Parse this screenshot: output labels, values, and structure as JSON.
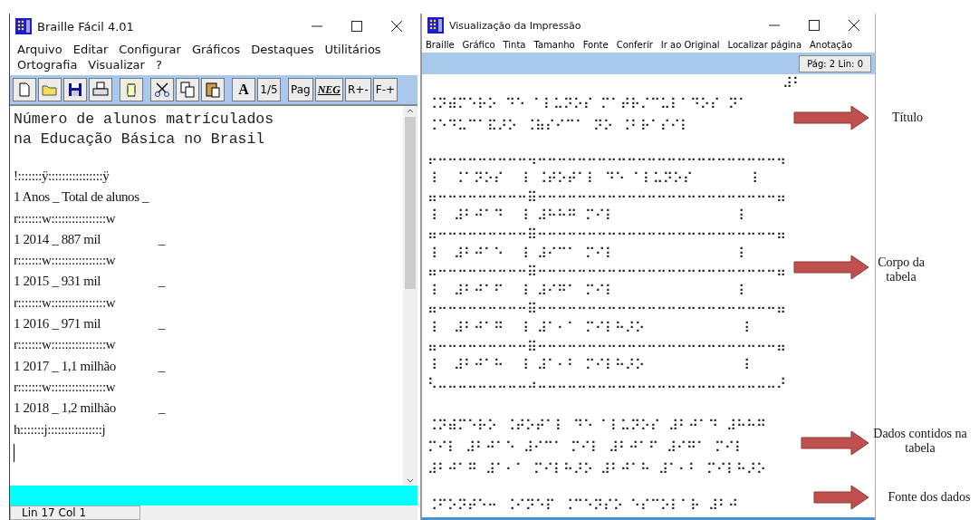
{
  "editor_window": {
    "title": "Braille Fácil 4.01",
    "menu": [
      "Arquivo",
      "Editar",
      "Configurar",
      "Gráficos",
      "Destaques",
      "Utilitários",
      "Ortografia",
      "Visualizar",
      "?"
    ],
    "toolbar_labels": [
      "A",
      "1/5",
      "Pag",
      "NEG",
      "R+-",
      "F-+"
    ],
    "heading": [
      "Número de alunos matrículados",
      "na Educação Básica no Brasil"
    ],
    "lines": [
      {
        "text": "!:::::::ÿ::::::::::::::::ÿ"
      },
      {
        "text": "1 Anos _ Total de alunos _"
      },
      {
        "text": "r:::::::w::::::::::::::::w"
      },
      {
        "text": "1 2014 _ 887 mil",
        "tail": "_"
      },
      {
        "text": "r:::::::w::::::::::::::::w"
      },
      {
        "text": "1 2015 _ 931 mil",
        "tail": "_"
      },
      {
        "text": "r:::::::w::::::::::::::::w"
      },
      {
        "text": "1 2016 _ 971 mil",
        "tail": "_"
      },
      {
        "text": "r:::::::w::::::::::::::::w"
      },
      {
        "text": "1 2017 _ 1,1 milhão",
        "tail": "_"
      },
      {
        "text": "r:::::::w::::::::::::::::w"
      },
      {
        "text": "1 2018 _ 1,2 milhão",
        "tail": "_"
      },
      {
        "text": "h:::::::j::::::::::::::::j"
      }
    ],
    "status": "Lin 17  Col 1"
  },
  "preview_window": {
    "title": "Visualização da Impressão",
    "menu": [
      "Braille",
      "Gráfico",
      "Tinta",
      "Tamanho",
      "Fonte",
      "Conferir",
      "Ir ao Original",
      "Localizar página",
      "Anotação"
    ],
    "page_indicator": "Pág: 2  Lin: 0",
    "page_number": "⠼⠃",
    "title_lines": [
      "⠨⠝⠾⠍⠑⠗⠕ ⠙⠑ ⠁⠇⠥⠝⠕⠎ ⠍⠁⠞⠗⠌⠉⠥⠇⠁⠙⠕⠎ ⠝⠁",
      "⠨⠑⠙⠥⠉⠁⠯⠜⠕ ⠨⠷⠎⠊⠉⠁ ⠝⠕ ⠨⠃⠗⠁⠎⠊⠇"
    ],
    "table_lines": [
      "⠖⠒⠒⠒⠒⠒⠒⠒⠒⠒⠲⠒⠒⠒⠒⠒⠒⠒⠒⠒⠒⠒⠒⠒⠒⠒⠒⠒⠒⠒⠒⠒⠒⠒⠒⠲",
      "⠸  ⠨⠁⠝⠕⠎  ⠸ ⠨⠞⠕⠞⠁⠇ ⠙⠑ ⠁⠇⠥⠝⠕⠎       ⠸",
      "⠶⠒⠒⠒⠒⠒⠒⠒⠒⠒⠿⠒⠒⠒⠒⠒⠒⠒⠒⠒⠒⠒⠒⠒⠒⠒⠒⠒⠒⠒⠒⠒⠒⠒⠒⠶",
      "⠸  ⠼⠃⠚⠁⠙  ⠸ ⠼⠓⠓⠛ ⠍⠊⠇               ⠸",
      "⠶⠒⠒⠒⠒⠒⠒⠒⠒⠒⠿⠒⠒⠒⠒⠒⠒⠒⠒⠒⠒⠒⠒⠒⠒⠒⠒⠒⠒⠒⠒⠒⠒⠒⠒⠶",
      "⠸  ⠼⠃⠚⠁⠑  ⠸ ⠼⠊⠉⠁ ⠍⠊⠇               ⠸",
      "⠶⠒⠒⠒⠒⠒⠒⠒⠒⠒⠿⠒⠒⠒⠒⠒⠒⠒⠒⠒⠒⠒⠒⠒⠒⠒⠒⠒⠒⠒⠒⠒⠒⠒⠒⠶",
      "⠸  ⠼⠃⠚⠁⠋  ⠸ ⠼⠊⠛⠁ ⠍⠊⠇               ⠸",
      "⠶⠒⠒⠒⠒⠒⠒⠒⠒⠒⠿⠒⠒⠒⠒⠒⠒⠒⠒⠒⠒⠒⠒⠒⠒⠒⠒⠒⠒⠒⠒⠒⠒⠒⠒⠶",
      "⠸  ⠼⠃⠚⠁⠛  ⠸ ⠼⠁⠂⠁ ⠍⠊⠇⠓⠜⠕            ⠸",
      "⠶⠒⠒⠒⠒⠒⠒⠒⠒⠒⠿⠒⠒⠒⠒⠒⠒⠒⠒⠒⠒⠒⠒⠒⠒⠒⠒⠒⠒⠒⠒⠒⠒⠒⠒⠶",
      "⠸  ⠼⠃⠚⠁⠓  ⠸ ⠼⠁⠂⠃ ⠍⠊⠇⠓⠜⠕            ⠸",
      "⠣⠤⠤⠤⠤⠤⠤⠤⠤⠤⠴⠤⠤⠤⠤⠤⠤⠤⠤⠤⠤⠤⠤⠤⠤⠤⠤⠤⠤⠤⠤⠤⠤⠤⠤⠜"
    ],
    "data_lines": [
      "⠨⠝⠾⠍⠑⠗⠕ ⠨⠞⠕⠞⠁⠇ ⠙⠑ ⠁⠇⠥⠝⠕⠎ ⠼⠃⠚⠁⠙ ⠼⠓⠓⠛",
      "⠍⠊⠇ ⠼⠃⠚⠁⠑ ⠼⠊⠉⠁ ⠍⠊⠇ ⠼⠃⠚⠁⠋ ⠼⠊⠛⠁ ⠍⠊⠇",
      "⠼⠃⠚⠁⠛ ⠼⠁⠂⠁ ⠍⠊⠇⠓⠜⠕ ⠼⠃⠚⠁⠓ ⠼⠁⠂⠃ ⠍⠊⠇⠓⠜⠕"
    ],
    "source_line": "⠨⠋⠕⠝⠞⠑⠒ ⠨⠊⠝⠑⠏ ⠨⠉⠑⠝⠎⠕ ⠑⠎⠉⠕⠇⠁⠗ ⠼⠃⠚"
  },
  "annotations": [
    {
      "label": "Título"
    },
    {
      "label": "Corpo da tabela"
    },
    {
      "label": "Dados contidos na tabela"
    },
    {
      "label": "Fonte dos dados"
    }
  ]
}
